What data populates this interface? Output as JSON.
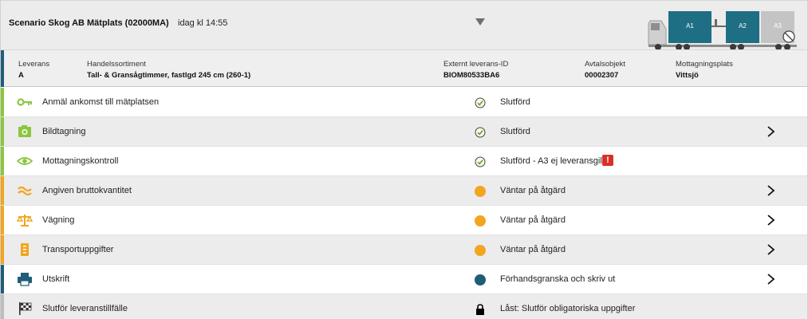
{
  "header": {
    "site_title": "Scenario Skog AB Mätplats (02000MA)",
    "time_text": "idag kl 14:55",
    "trailers": [
      "A1",
      "A2",
      "A3"
    ]
  },
  "delivery": {
    "leverans": {
      "label": "Leverans",
      "value": "A"
    },
    "handelssortiment": {
      "label": "Handelssortiment",
      "value": "Tall- & Gransågtimmer, fastlgd 245 cm (260-1)"
    },
    "externt_id": {
      "label": "Externt leverans-ID",
      "value": "BIOM80533BA6"
    },
    "avtalsobjekt": {
      "label": "Avtalsobjekt",
      "value": "00002307"
    },
    "mottagningsplats": {
      "label": "Mottagningsplats",
      "value": "Vittsjö"
    }
  },
  "tasks": [
    {
      "label": "Anmäl ankomst till mätplatsen",
      "icon": "key-icon",
      "status": "Slutförd",
      "status_icon": "check-icon",
      "has_chevron": false,
      "stripe": "#8cc63f"
    },
    {
      "label": "Bildtagning",
      "icon": "camera-icon",
      "status": "Slutförd",
      "status_icon": "check-icon",
      "has_chevron": true,
      "stripe": "#8cc63f"
    },
    {
      "label": "Mottagningskontroll",
      "icon": "eye-icon",
      "status": "Slutförd - A3 ej leveransgill",
      "status_icon": "check-icon",
      "alert": "!",
      "has_chevron": false,
      "stripe": "#8cc63f"
    },
    {
      "label": "Angiven bruttokvantitet",
      "icon": "approx-icon",
      "status": "Väntar på åtgärd",
      "status_icon": "pending-dot-icon",
      "has_chevron": true,
      "stripe": "#f2a51e"
    },
    {
      "label": "Vägning",
      "icon": "scale-icon",
      "status": "Väntar på åtgärd",
      "status_icon": "pending-dot-icon",
      "has_chevron": true,
      "stripe": "#f2a51e"
    },
    {
      "label": "Transportuppgifter",
      "icon": "document-icon",
      "status": "Väntar på åtgärd",
      "status_icon": "pending-dot-icon",
      "has_chevron": true,
      "stripe": "#f2a51e"
    },
    {
      "label": "Utskrift",
      "icon": "printer-icon",
      "status": "Förhandsgranska och skriv ut",
      "status_icon": "info-dot-icon",
      "has_chevron": true,
      "stripe": "#1f5d79"
    },
    {
      "label": "Slutför leveranstillfälle",
      "icon": "checkered-flag-icon",
      "status": "Låst: Slutför obligatoriska uppgifter",
      "status_icon": "lock-icon",
      "has_chevron": false,
      "stripe": "#bdbdbd"
    }
  ],
  "colors": {
    "green": "#8cc63f",
    "orange": "#f2a51e",
    "teal": "#1f5d79",
    "alert_red": "#d93025"
  }
}
